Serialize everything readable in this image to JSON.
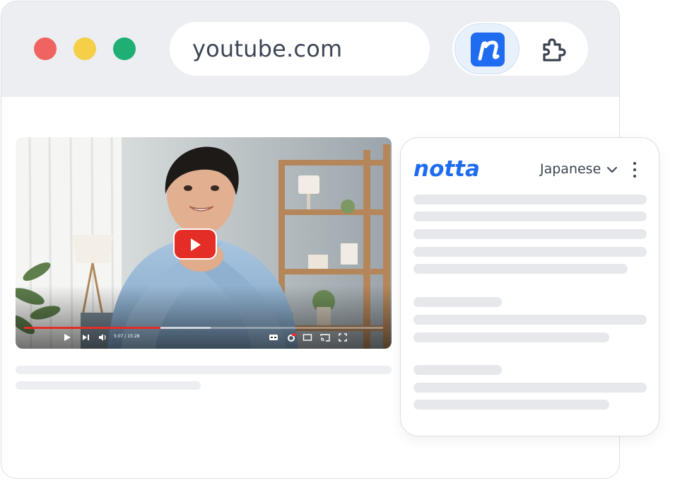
{
  "browser": {
    "url": "youtube.com",
    "traffic_lights": [
      "#ef6461",
      "#f5cf47",
      "#1fae74"
    ],
    "extensions": [
      "notta-extension-icon",
      "puzzle-icon"
    ]
  },
  "video": {
    "timecode": "5:07 / 15:28",
    "progress_fraction": 0.38,
    "buffer_fraction": 0.52,
    "play_button_color": "#e52d27",
    "controls": [
      "play-icon",
      "next-icon",
      "volume-icon",
      "captions-icon",
      "settings-icon",
      "miniplayer-icon",
      "cast-icon",
      "fullscreen-icon"
    ]
  },
  "panel": {
    "logo": "notta",
    "language": "Japanese",
    "brand_color": "#1f6cf0"
  }
}
